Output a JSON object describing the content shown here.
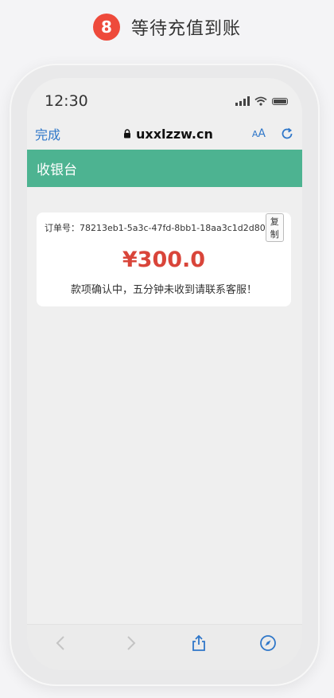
{
  "step": {
    "number": "8",
    "title": "等待充值到账",
    "badge_color": "#ee4a3b"
  },
  "status_bar": {
    "time": "12:30"
  },
  "browser": {
    "done_label": "完成",
    "url": "uxxlzzw.cn",
    "text_size_label_small": "A",
    "text_size_label_large": "A"
  },
  "cashier": {
    "title": "收银台",
    "color": "#4db391"
  },
  "order": {
    "label": "订单号：",
    "id": "78213eb1-5a3c-47fd-8bb1-18aa3c1d2d80",
    "copy_label": "复制",
    "amount": "¥300.0",
    "message": "款项确认中，五分钟未收到请联系客服！"
  },
  "toolbar": {
    "icons": [
      "back-icon",
      "forward-icon",
      "share-icon",
      "compass-icon"
    ]
  }
}
